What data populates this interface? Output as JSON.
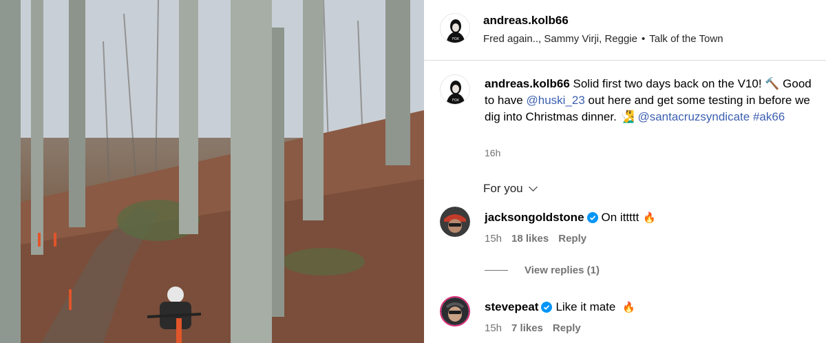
{
  "post": {
    "author": "andreas.kolb66",
    "audio_artists": "Fred again.., Sammy Virji, Reggie",
    "audio_separator": "•",
    "audio_title": "Talk of the Town"
  },
  "caption": {
    "username": "andreas.kolb66",
    "part1": " Solid first two days back on the V10! 🔨",
    "part2": " Good to have ",
    "mention1": "@huski_23",
    "part3": " out here and get some testing in before we dig into Christmas dinner. 🧏‍♂️ ",
    "mention2": "@santacruzsyndicate",
    "hashtag": " #ak66",
    "time": "16h"
  },
  "for_you": {
    "label": "For you"
  },
  "comments": [
    {
      "username": "jacksongoldstone",
      "text": "On ittttt",
      "emoji": "🔥",
      "time": "15h",
      "likes": "18 likes",
      "reply": "Reply"
    },
    {
      "username": "stevepeat",
      "text": "Like it mate",
      "emoji": "🔥",
      "time": "15h",
      "likes": "7 likes",
      "reply": "Reply"
    }
  ],
  "view_replies": {
    "label": "View replies (1)"
  },
  "colors": {
    "link": "#3b5fb0",
    "muted": "#737373",
    "verified": "#0095f6"
  },
  "icons": [
    "verified-badge-icon",
    "chevron-down-icon",
    "fire-emoji",
    "hammer-emoji"
  ]
}
